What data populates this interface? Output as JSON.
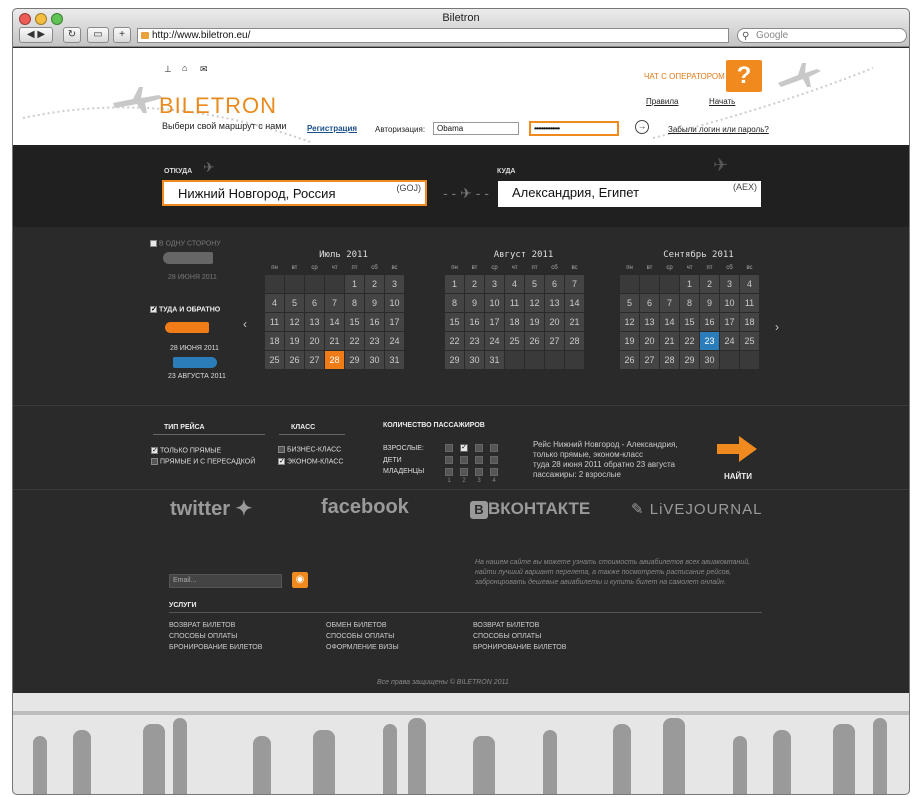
{
  "browser": {
    "title": "Biletron",
    "url": "http://www.biletron.eu/",
    "search_placeholder": "Google"
  },
  "header": {
    "logo": "BILETRON",
    "tagline": "Выбери свой маршрут с нами",
    "register": "Регистрация",
    "auth_label": "Авторизация:",
    "login_value": "Obama",
    "password_value": "••••••••••••••",
    "forgot": "Забыли логин или пароль?",
    "chat": "ЧАТ С ОПЕРАТОРОМ",
    "help_icon": "?",
    "rules": "Правила",
    "start": "Начать"
  },
  "route": {
    "from_label": "ОТКУДА",
    "from_value": "Нижний Новгород, Россия",
    "from_code": "(GOJ)",
    "to_label": "КУДА",
    "to_value": "Александрия, Египет",
    "to_code": "(AEX)"
  },
  "trip": {
    "oneway_label": "В ОДНУ СТОРОНУ",
    "oneway_date": "28 ИЮНЯ 2011",
    "round_label": "ТУДА И ОБРАТНО",
    "round_date1": "28 ИЮНЯ 2011",
    "round_date2": "23 АВГУСТА 2011"
  },
  "calendar": {
    "dow": [
      "пн",
      "вт",
      "ср",
      "чт",
      "пт",
      "сб",
      "вс"
    ],
    "months": [
      {
        "title": "Июль 2011",
        "offset": 4,
        "days": 31,
        "selected": 28
      },
      {
        "title": "Август 2011",
        "offset": 0,
        "days": 31,
        "selected": 0
      },
      {
        "title": "Сентябрь 2011",
        "offset": 3,
        "days": 30,
        "selected": 23
      }
    ]
  },
  "options": {
    "type_heading": "ТИП РЕЙСА",
    "direct": "ТОЛЬКО ПРЯМЫЕ",
    "transfer": "ПРЯМЫЕ И С ПЕРЕСАДКОЙ",
    "class_heading": "КЛАСС",
    "business": "БИЗНЕС-КЛАСС",
    "economy": "ЭКОНОМ-КЛАСС",
    "pax_heading": "КОЛИЧЕСТВО ПАССАЖИРОВ",
    "adults": "ВЗРОСЛЫЕ:",
    "children": "ДЕТИ",
    "infants": "МЛАДЕНЦЫ",
    "pax_nums": [
      "1",
      "2",
      "3",
      "4"
    ],
    "summary1": "Рейс Нижний Новгород - Александрия,",
    "summary2": "только прямые, эконом-класс",
    "summary3": "туда 28 июня 2011 обратно 23 августа",
    "summary4": "пассажиры: 2 взрослые",
    "find": "НАЙТИ"
  },
  "social": {
    "twitter": "twitter",
    "facebook": "facebook",
    "vk": "ВКОНТАКТЕ",
    "lj": "LiVEJOURNAL"
  },
  "footer": {
    "email_placeholder": "Email...",
    "promo1": "На нашем сайте вы можете узнать стоимость авиабилетов всех авиакомпаний,",
    "promo2": "найти лучший вариант перелета, а также посмотреть расписание рейсов,",
    "promo3": "забронировать дешевые авиабилеты и купить билет на самолет онлайн.",
    "services": "УСЛУГИ",
    "col1": [
      "ВОЗВРАТ БИЛЕТОВ",
      "СПОСОБЫ ОПЛАТЫ",
      "БРОНИРОВАНИЕ БИЛЕТОВ"
    ],
    "col2": [
      "ОБМЕН БИЛЕТОВ",
      "СПОСОБЫ ОПЛАТЫ",
      "ОФОРМЛЕНИЕ ВИЗЫ"
    ],
    "col3": [
      "ВОЗВРАТ БИЛЕТОВ",
      "СПОСОБЫ ОПЛАТЫ",
      "БРОНИРОВАНИЕ БИЛЕТОВ"
    ],
    "copyright": "Все права защищены © BILETRON 2011"
  },
  "colors": {
    "accent": "#f07c18",
    "blue": "#2a7db8"
  }
}
